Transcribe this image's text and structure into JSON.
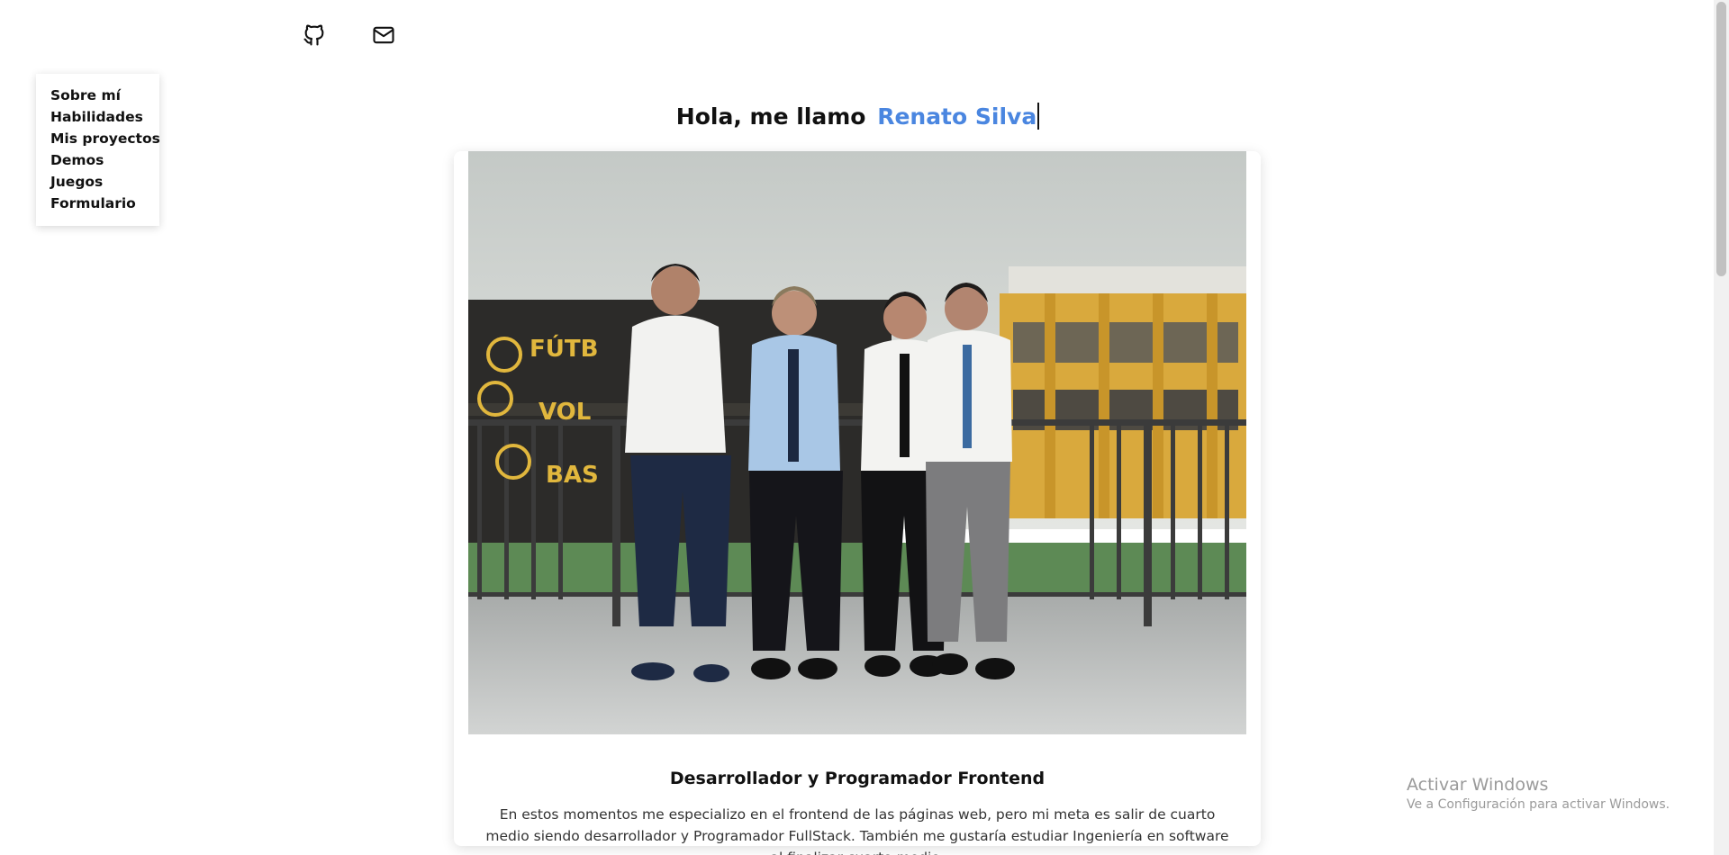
{
  "social": {
    "github_icon": "github-icon",
    "mail_icon": "mail-icon"
  },
  "nav": {
    "items": [
      {
        "label": "Sobre mí"
      },
      {
        "label": "Habilidades"
      },
      {
        "label": "Mis proyectos"
      },
      {
        "label": "Demos"
      },
      {
        "label": "Juegos"
      },
      {
        "label": "Formulario"
      }
    ]
  },
  "hero": {
    "greeting": "Hola, me llamo",
    "name": "Renato Silva"
  },
  "card": {
    "title": "Desarrollador y Programador Frontend",
    "description": "En estos momentos me especializo en el frontend de las páginas web, pero mi meta es salir de cuarto medio siendo desarrollador y Programador FullStack. También me gustaría estudiar Ingeniería en software al finalizar cuarto medio.",
    "photo_sign_texts": [
      "FÚTB",
      "VOL",
      "BAS"
    ]
  },
  "watermark": {
    "title": "Activar Windows",
    "subtitle": "Ve a Configuración para activar Windows."
  },
  "colors": {
    "accent": "#4a86e0",
    "text": "#111111"
  }
}
